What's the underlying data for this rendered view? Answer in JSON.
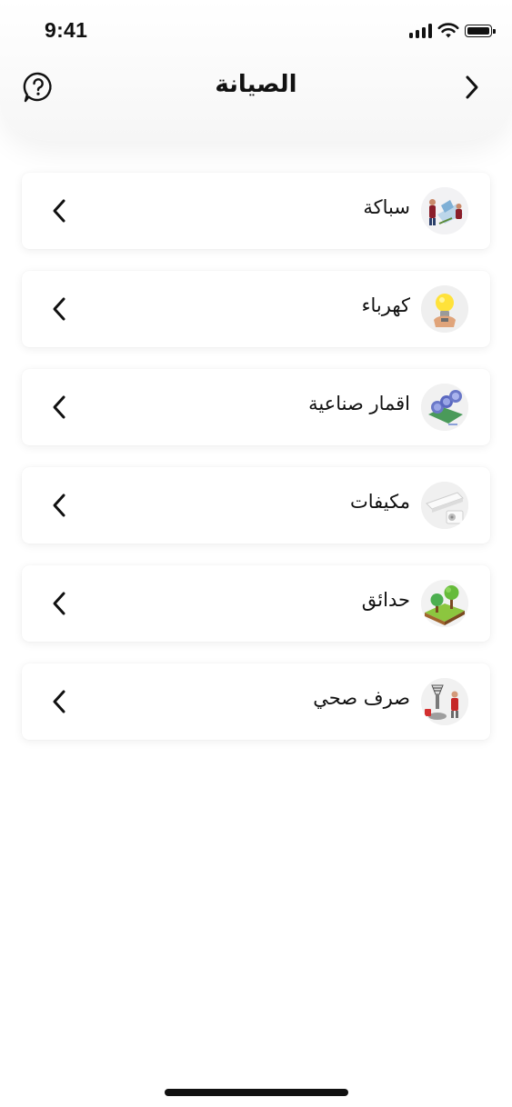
{
  "status_bar": {
    "time": "9:41"
  },
  "header": {
    "title": "الصيانة"
  },
  "items": [
    {
      "label": "سباكة",
      "icon": "plumbing-icon"
    },
    {
      "label": "كهرباء",
      "icon": "electricity-bulb-icon"
    },
    {
      "label": "اقمار صناعية",
      "icon": "satellite-dish-icon"
    },
    {
      "label": "مكيفات",
      "icon": "air-conditioner-icon"
    },
    {
      "label": "حدائق",
      "icon": "garden-tree-icon"
    },
    {
      "label": "صرف صحي",
      "icon": "sewage-drain-icon"
    }
  ]
}
